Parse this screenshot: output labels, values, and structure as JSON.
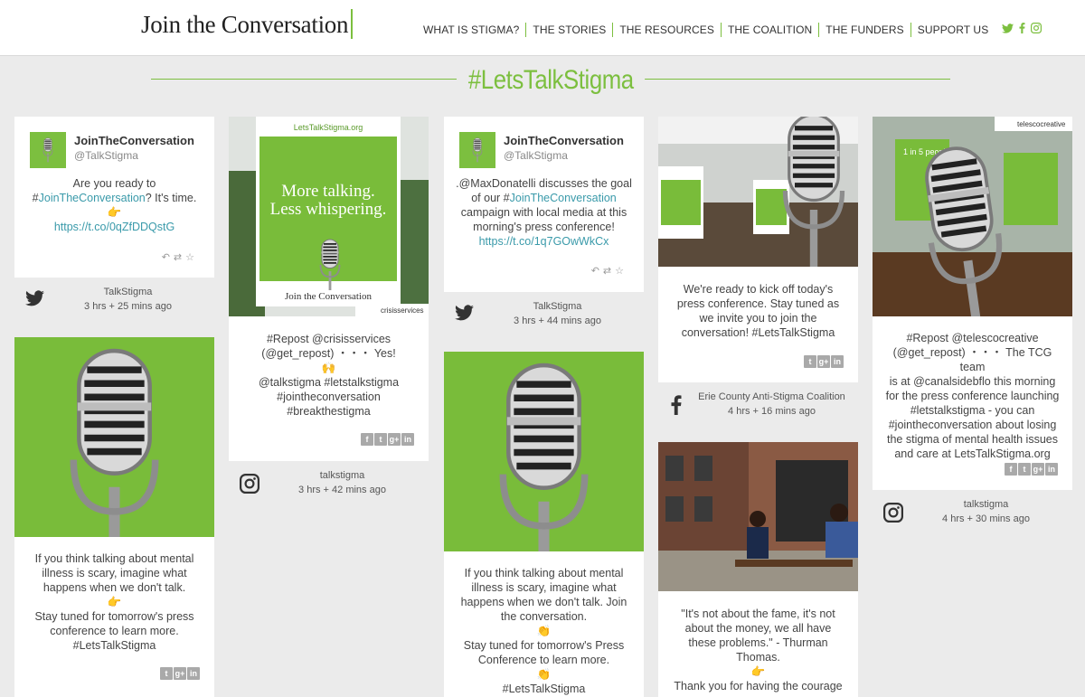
{
  "header": {
    "logo": "Join the Conversation",
    "nav": [
      "WHAT IS STIGMA?",
      "THE STORIES",
      "THE RESOURCES",
      "THE COALITION",
      "THE FUNDERS",
      "SUPPORT US"
    ]
  },
  "hashtag": "#LetsTalkStigma",
  "colors": {
    "accent": "#7cbf3f",
    "link": "#3a9aaa"
  },
  "cards": {
    "c1": {
      "name": "JoinTheConversation",
      "handle": "@TalkStigma",
      "line1": "Are you ready to",
      "line2_pre": "#",
      "line2_link": "JoinTheConversation",
      "line2_post": "? It's time.",
      "emoji": "👉",
      "url": "https://t.co/0qZfDDQstG"
    },
    "m1": {
      "name": "TalkStigma",
      "time": "3 hrs + 25 mins ago",
      "network": "twitter-icon"
    },
    "c2": {
      "lines": [
        "If you think talking about mental",
        "illness is scary, imagine what",
        "happens when we don't talk.",
        "👉",
        "Stay tuned for tomorrow's press",
        "conference to learn more.",
        "#LetsTalkStigma"
      ]
    },
    "c3": {
      "photo_credit": "crisisservices",
      "sign_top": "LetsTalkStigma.org",
      "sign_main1": "More talking.",
      "sign_main2": "Less whispering.",
      "sign_bottom": "Join the Conversation",
      "lines": [
        "#Repost @crisisservices",
        "(@get_repost) ・・・ Yes!",
        "🙌",
        "@talkstigma #letstalkstigma",
        "#jointheconversation",
        "#breakthestigma"
      ]
    },
    "m3": {
      "name": "talkstigma",
      "time": "3 hrs + 42 mins ago",
      "network": "instagram-icon"
    },
    "c4": {
      "name": "JoinTheConversation",
      "handle": "@TalkStigma",
      "lines_pre": [
        ".@MaxDonatelli discusses the goal"
      ],
      "line2_pre": "of our #",
      "line2_link": "JoinTheConversation",
      "lines_post": [
        "campaign with local media at this",
        "morning's press conference!"
      ],
      "url": "https://t.co/1q7GOwWkCx"
    },
    "m4": {
      "name": "TalkStigma",
      "time": "3 hrs + 44 mins ago",
      "network": "twitter-icon"
    },
    "c5": {
      "lines": [
        "If you think talking about mental",
        "illness is scary, imagine what",
        "happens when we don't talk. Join",
        "the conversation.",
        "👏",
        "Stay tuned for tomorrow's Press",
        "Conference to learn more.",
        "👏",
        "#LetsTalkStigma"
      ]
    },
    "c6": {
      "lines": [
        "We're ready to kick off today's",
        "press conference. Stay tuned as",
        "we invite you to join the",
        "conversation! #LetsTalkStigma"
      ]
    },
    "m6": {
      "name": "Erie County Anti-Stigma Coalition",
      "time": "4 hrs + 16 mins ago",
      "network": "facebook-icon"
    },
    "c7": {
      "lines": [
        "\"It's not about the fame, it's not",
        "about the money, we all have",
        "these problems.\" - Thurman",
        "Thomas.",
        "👉",
        "Thank you for having the courage"
      ]
    },
    "c8": {
      "photo_credit": "telescocreative",
      "lines": [
        "#Repost @telescocreative",
        "(@get_repost) ・・・ The TCG team",
        "is at @canalsidebflo this morning",
        "for the press conference launching",
        "#letstalkstigma - you can",
        "#jointheconversation about losing",
        "the stigma of mental health issues",
        "and care at LetsTalkStigma.org"
      ]
    },
    "m8": {
      "name": "talkstigma",
      "time": "4 hrs + 30 mins ago",
      "network": "instagram-icon"
    }
  }
}
